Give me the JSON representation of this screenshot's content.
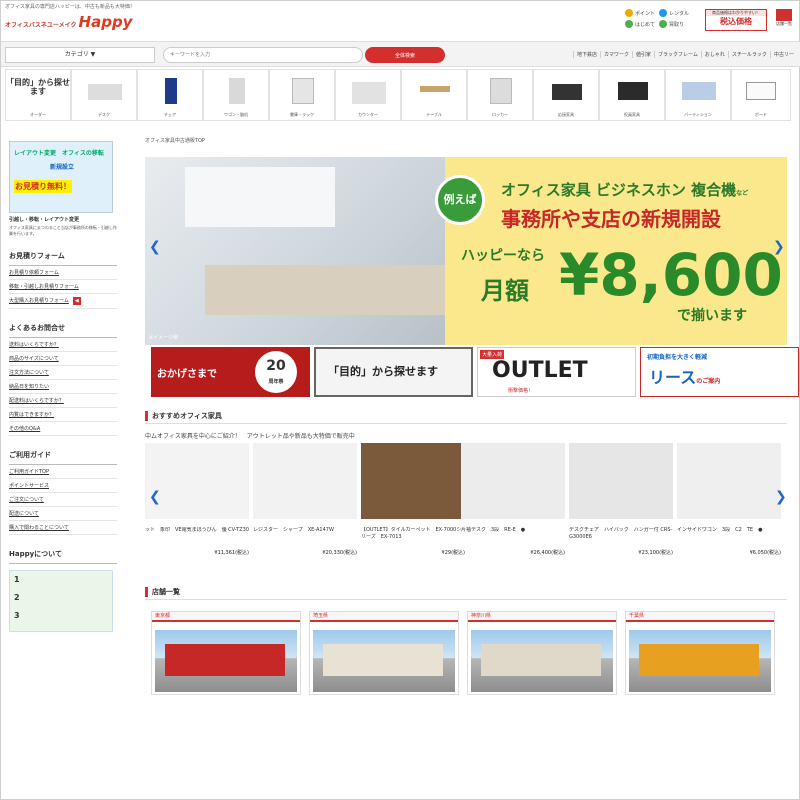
{
  "header": {
    "tagline": "オフィス家具の専門店ハッピーは、中古も新品も大特価！",
    "logo_sub": "オフィスバスネユーメイク",
    "logo_main": "Happy",
    "icons": [
      {
        "label": "ポイント",
        "color": "#f2a900"
      },
      {
        "label": "はじめて",
        "color": "#4caf50"
      },
      {
        "label": "レンタル",
        "color": "#2196f3"
      },
      {
        "label": "買取り",
        "color": "#4caf50"
      }
    ],
    "tax_note": "商品価格はわかりやすい！",
    "tax_label": "税込価格",
    "home_label": "店舗一覧"
  },
  "search": {
    "category_label": "カテゴリ ▼",
    "placeholder": "キーワードを入力",
    "button_label": "全体検索",
    "quick_links": [
      "地下鉄店",
      "カマワーク",
      "値引家",
      "ブラックフレーム",
      "おしゃれ",
      "スチールラック",
      "中古リー"
    ]
  },
  "categories": [
    {
      "label": "オーダー",
      "head": "「目的」から探せます"
    },
    {
      "label": "デスク"
    },
    {
      "label": "チェア"
    },
    {
      "label": "ワゴン・脇机"
    },
    {
      "label": "書庫・ラック"
    },
    {
      "label": "カウンター"
    },
    {
      "label": "テーブル"
    },
    {
      "label": "ロッカー"
    },
    {
      "label": "応接家具"
    },
    {
      "label": "役員家具"
    },
    {
      "label": "パーティション"
    },
    {
      "label": "ボード"
    }
  ],
  "sidebar": {
    "banner_top": "レイアウト変更　オフィスの移転",
    "banner_mid": "新規設立",
    "banner_free": "お見積り無料！",
    "banner_caption": "引越し・移転・レイアウト変更",
    "banner_desc": "オフィス家具にまつわること当店が事務所の移転・引越し作業を行います。",
    "estimate_head": "お見積りフォーム",
    "estimate_links": [
      "お見積り依頼フォーム",
      "移転・引越しお見積りフォーム",
      "大型購入お見積りフォーム"
    ],
    "faq_head": "よくあるお問合せ",
    "faq_links": [
      "送料はいくらですか？",
      "商品のサイズについて",
      "注文方法について",
      "納品日を知りたい",
      "配送料はいくらですか？",
      "内覧はできますか？",
      "その他のQ&A"
    ],
    "guide_head": "ご利用ガイド",
    "guide_links": [
      "ご利用ガイドTOP",
      "ポイントサービス",
      "ご注文について",
      "配送について",
      "購入で関わることについて"
    ],
    "about_head": "Happyについて",
    "about_points": [
      "1",
      "2",
      "3"
    ]
  },
  "main": {
    "breadcrumb": "オフィス家具中古通販TOP",
    "hero": {
      "badge": "例えば",
      "line1": "オフィス家具 ビジネスホン 複合機",
      "line1_small": "など",
      "line2": "事務所や支店の新規開設",
      "line3": "ハッピーなら",
      "line4": "月額",
      "price": "¥8,600",
      "line5": "で揃います",
      "note": "※イメージ例"
    },
    "promos": {
      "p1_text": "おかげさまで",
      "p1_num": "20",
      "p1_sub": "周年祭",
      "p2_text": "「目的」から探せます",
      "p3_tag": "大量入荷",
      "p3_text": "OUTLET",
      "p3_sub": "衝撃価格！",
      "p4_top": "初期負担を大きく軽減",
      "p4_text": "リース",
      "p4_small": "のご案内"
    },
    "recommend_title": "おすすめオフィス家具",
    "recommend_desc": "中ムオフィス家具を中心にご紹介！　アウトレット品や新品も大特価で販売中",
    "products": [
      {
        "name": "ット　象印　VE電気まほうびん　優 CV-TZ30",
        "price": "¥11,361(税込)",
        "color": "#f3f3f3"
      },
      {
        "name": "レジスター　シャープ　XE-A147W",
        "price": "¥20,330(税込)",
        "color": "#f2f2f2"
      },
      {
        "name": "【OUTLET】タイルカーペット　EX-7000シリーズ　EX-7013",
        "price": "¥29(税込)",
        "color": "#7a5a3a"
      },
      {
        "name": "片袖デスク　3段　RE-E　●",
        "price": "¥26,400(税込)",
        "color": "#ececec"
      },
      {
        "name": "デスクチェア　ハイバック　ハンガー付 CRS-G3000E6",
        "price": "¥23,100(税込)",
        "color": "#e6e6e6"
      },
      {
        "name": "インサイドワゴン　3段　C2　TE　●",
        "price": "¥6,050(税込)",
        "color": "#efefef"
      }
    ],
    "stores_title": "店舗一覧",
    "stores": [
      {
        "pref": "東京都"
      },
      {
        "pref": "埼玉県"
      },
      {
        "pref": "神奈川県"
      },
      {
        "pref": "千葉県"
      }
    ]
  }
}
